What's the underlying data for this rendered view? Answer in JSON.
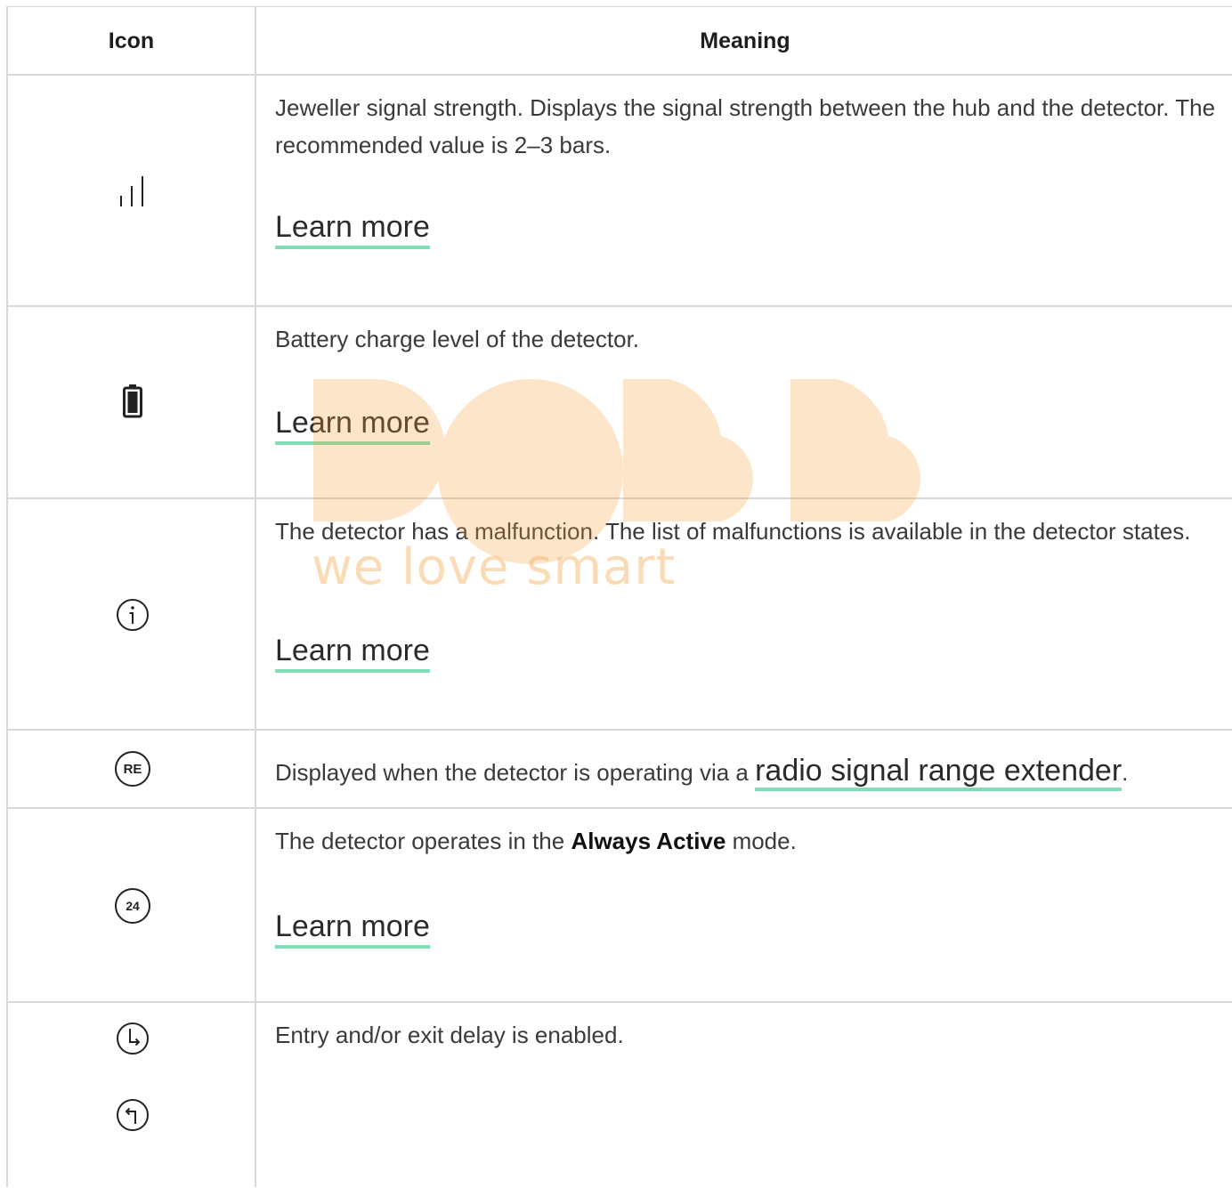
{
  "header": {
    "icon_col": "Icon",
    "meaning_col": "Meaning"
  },
  "rows": [
    {
      "icon": "signal-strength-icon",
      "text": "Jeweller signal strength. Displays the signal strength between the hub and the detector. The recommended value is 2–3 bars.",
      "link": "Learn more"
    },
    {
      "icon": "battery-icon",
      "text": "Battery charge level of the detector.",
      "link": "Learn more"
    },
    {
      "icon": "info-icon",
      "text": "The detector has a malfunction. The list of malfunctions is available in the detector states.",
      "link": "Learn more"
    },
    {
      "icon": "range-extender-icon",
      "icon_text": "RE",
      "text_before": "Displayed when the detector is operating via a ",
      "link": "radio signal range extender",
      "text_after": "."
    },
    {
      "icon": "always-active-icon",
      "icon_text": "24",
      "text_before": "The detector operates in the ",
      "text_bold": "Always Active",
      "text_after": " mode.",
      "link": "Learn more"
    },
    {
      "icons": [
        "entry-delay-icon",
        "exit-delay-icon"
      ],
      "text": "Entry and/or exit delay is enabled."
    }
  ],
  "watermark": {
    "text": "we love smart",
    "color": "#f8b96f"
  },
  "colors": {
    "link_underline": "#7ddfb3",
    "border": "#d8d8d8"
  }
}
